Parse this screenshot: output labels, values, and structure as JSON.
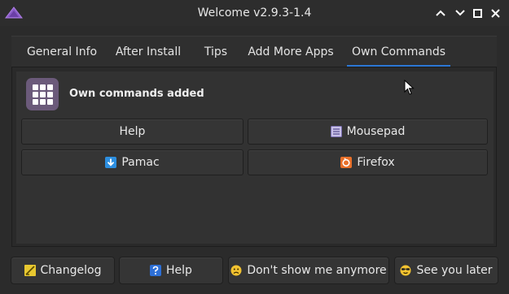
{
  "window": {
    "title": "Welcome v2.9.3-1.4"
  },
  "tabs": [
    {
      "label": "General Info"
    },
    {
      "label": "After Install"
    },
    {
      "label": "Tips"
    },
    {
      "label": "Add More Apps"
    },
    {
      "label": "Own Commands",
      "active": true
    }
  ],
  "section": {
    "title": "Own commands added",
    "icon": "app-grid-icon"
  },
  "commands": [
    {
      "label": "Help",
      "icon": ""
    },
    {
      "label": "Mousepad",
      "icon": "mousepad-icon"
    },
    {
      "label": "Pamac",
      "icon": "pamac-download-icon"
    },
    {
      "label": "Firefox",
      "icon": "firefox-icon"
    }
  ],
  "bottom": [
    {
      "label": "Changelog",
      "icon": "changelog-icon"
    },
    {
      "label": "Help",
      "icon": "question-icon"
    },
    {
      "label": "Don't show me anymore",
      "icon": "sad-face-icon"
    },
    {
      "label": "See you later",
      "icon": "sunglasses-face-icon"
    }
  ],
  "colors": {
    "accent": "#2b78d6",
    "logo": "#8a5cc8"
  }
}
